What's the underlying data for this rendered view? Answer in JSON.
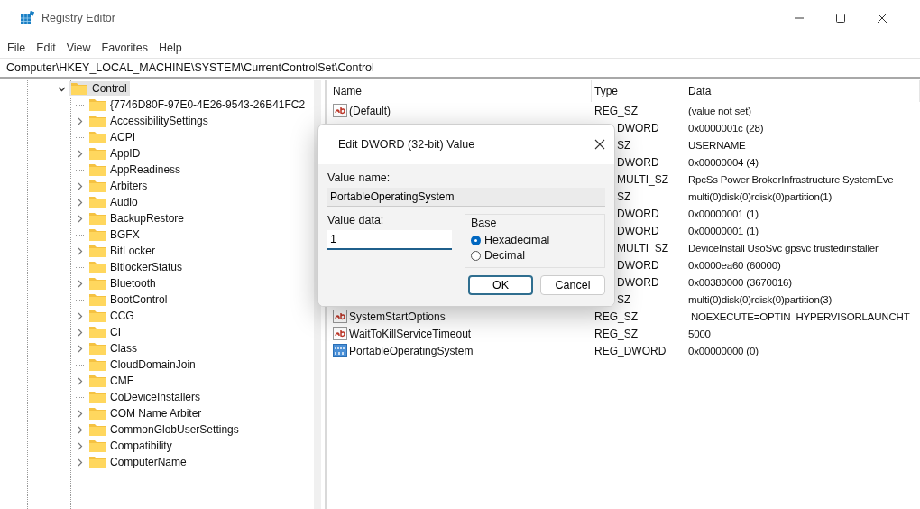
{
  "window": {
    "title": "Registry Editor"
  },
  "menu": [
    "File",
    "Edit",
    "View",
    "Favorites",
    "Help"
  ],
  "address": "Computer\\HKEY_LOCAL_MACHINE\\SYSTEM\\CurrentControlSet\\Control",
  "tree": [
    {
      "label": "Control",
      "expanded": true,
      "selected": true,
      "children": [
        {
          "label": "{7746D80F-97E0-4E26-9543-26B41FC2",
          "expandable": false
        },
        {
          "label": "AccessibilitySettings",
          "expandable": true
        },
        {
          "label": "ACPI",
          "expandable": false
        },
        {
          "label": "AppID",
          "expandable": true
        },
        {
          "label": "AppReadiness",
          "expandable": false
        },
        {
          "label": "Arbiters",
          "expandable": true
        },
        {
          "label": "Audio",
          "expandable": true
        },
        {
          "label": "BackupRestore",
          "expandable": true
        },
        {
          "label": "BGFX",
          "expandable": false
        },
        {
          "label": "BitLocker",
          "expandable": true
        },
        {
          "label": "BitlockerStatus",
          "expandable": false
        },
        {
          "label": "Bluetooth",
          "expandable": true
        },
        {
          "label": "BootControl",
          "expandable": false
        },
        {
          "label": "CCG",
          "expandable": true
        },
        {
          "label": "CI",
          "expandable": true
        },
        {
          "label": "Class",
          "expandable": true
        },
        {
          "label": "CloudDomainJoin",
          "expandable": false
        },
        {
          "label": "CMF",
          "expandable": true
        },
        {
          "label": "CoDeviceInstallers",
          "expandable": false
        },
        {
          "label": "COM Name Arbiter",
          "expandable": true
        },
        {
          "label": "CommonGlobUserSettings",
          "expandable": true
        },
        {
          "label": "Compatibility",
          "expandable": true
        },
        {
          "label": "ComputerName",
          "expandable": true
        }
      ]
    }
  ],
  "table": {
    "columns": [
      "Name",
      "Type",
      "Data"
    ],
    "rows": [
      {
        "kind": "string",
        "name": "(Default)",
        "type": "REG_SZ",
        "data": "(value not set)"
      },
      {
        "kind": "covered",
        "type": "DWORD",
        "data": "0x0000001c (28)"
      },
      {
        "kind": "covered",
        "type": "SZ",
        "data": "USERNAME"
      },
      {
        "kind": "covered",
        "type": "DWORD",
        "data": "0x00000004 (4)"
      },
      {
        "kind": "covered",
        "type": "MULTI_SZ",
        "data": "RpcSs Power BrokerInfrastructure SystemEve"
      },
      {
        "kind": "covered",
        "type": "SZ",
        "data": "multi(0)disk(0)rdisk(0)partition(1)"
      },
      {
        "kind": "covered",
        "type": "DWORD",
        "data": "0x00000001 (1)"
      },
      {
        "kind": "covered",
        "type": "DWORD",
        "data": "0x00000001 (1)"
      },
      {
        "kind": "covered",
        "type": "MULTI_SZ",
        "data": "DeviceInstall UsoSvc gpsvc trustedinstaller"
      },
      {
        "kind": "covered",
        "type": "DWORD",
        "data": "0x0000ea60 (60000)"
      },
      {
        "kind": "covered",
        "type": "DWORD",
        "data": "0x00380000 (3670016)"
      },
      {
        "kind": "covered",
        "type": "SZ",
        "data": "multi(0)disk(0)rdisk(0)partition(3)"
      },
      {
        "kind": "string",
        "name": "SystemStartOptions",
        "type": "REG_SZ",
        "data": " NOEXECUTE=OPTIN  HYPERVISORLAUNCHT"
      },
      {
        "kind": "string",
        "name": "WaitToKillServiceTimeout",
        "type": "REG_SZ",
        "data": "5000"
      },
      {
        "kind": "dword",
        "name": "PortableOperatingSystem",
        "type": "REG_DWORD",
        "data": "0x00000000 (0)"
      }
    ]
  },
  "dialog": {
    "title": "Edit DWORD (32-bit) Value",
    "value_name_label": "Value name:",
    "value_name": "PortableOperatingSystem",
    "value_data_label": "Value data:",
    "value_data": "1",
    "base_label": "Base",
    "bases": [
      {
        "label": "Hexadecimal",
        "selected": true
      },
      {
        "label": "Decimal",
        "selected": false
      }
    ],
    "buttons": [
      {
        "label": "OK",
        "kind": "default"
      },
      {
        "label": "Cancel",
        "kind": "normal"
      }
    ]
  }
}
